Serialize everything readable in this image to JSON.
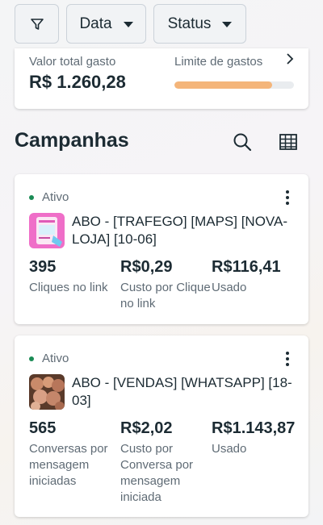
{
  "filters": {
    "filter_icon": "filter-icon",
    "date_label": "Data",
    "status_label": "Status"
  },
  "spend": {
    "total_label": "Valor total gasto",
    "total_value": "R$ 1.260,28",
    "limit_label": "Limite de gastos",
    "limit_progress": 0.82,
    "progress_color": "#f4b57a"
  },
  "campaigns_section": {
    "title": "Campanhas",
    "search_icon": "search-icon",
    "table_icon": "table-icon"
  },
  "campaigns": [
    {
      "status": "Ativo",
      "name": "ABO - [TRAFEGO] [MAPS] [NOVA-LOJA] [10-06]",
      "metrics": [
        {
          "value": "395",
          "label": "Cliques no link"
        },
        {
          "value": "R$0,29",
          "label": "Custo por Clique no link"
        },
        {
          "value": "R$116,41",
          "label": "Usado"
        }
      ]
    },
    {
      "status": "Ativo",
      "name": "ABO - [VENDAS] [WHATSAPP] [18-03]",
      "metrics": [
        {
          "value": "565",
          "label": "Conversas por mensagem iniciadas"
        },
        {
          "value": "R$2,02",
          "label": "Custo por Conversa por mensagem iniciada"
        },
        {
          "value": "R$1.143,87",
          "label": "Usado"
        }
      ]
    }
  ],
  "colors": {
    "status_active": "#1a8b55",
    "text_primary": "#1c2b33",
    "text_secondary": "#5f6b75"
  }
}
